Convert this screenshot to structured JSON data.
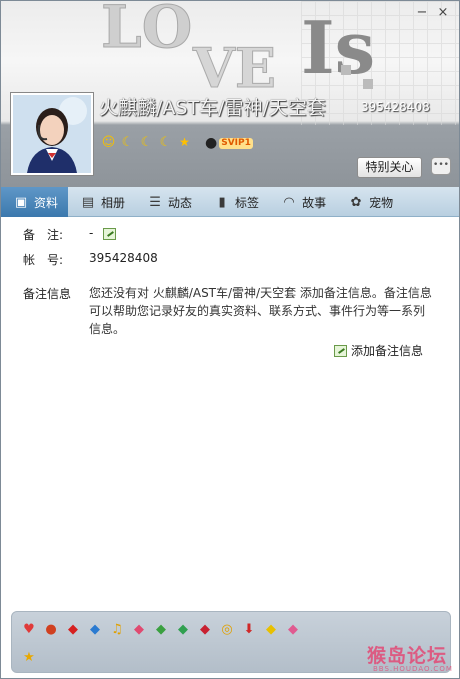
{
  "window": {
    "minimize_glyph": "−",
    "close_glyph": "×"
  },
  "header": {
    "nickname": "火麒麟/AST车/雷神/天空套",
    "qq_number": "395428408",
    "levels": [
      "sun-icon",
      "moon-icon",
      "moon-icon",
      "moon-icon",
      "star-icon"
    ],
    "svip_label": "SVIP1",
    "special_care_label": "特别关心",
    "chat_glyph": "•••"
  },
  "tabs": [
    {
      "label": "资料",
      "icon": "profile-card-icon",
      "glyph": "▣",
      "active": true
    },
    {
      "label": "相册",
      "icon": "album-icon",
      "glyph": "▤",
      "active": false
    },
    {
      "label": "动态",
      "icon": "feed-icon",
      "glyph": "☰",
      "active": false
    },
    {
      "label": "标签",
      "icon": "bookmark-icon",
      "glyph": "▮",
      "active": false
    },
    {
      "label": "故事",
      "icon": "signal-icon",
      "glyph": "◠",
      "active": false
    },
    {
      "label": "宠物",
      "icon": "pet-icon",
      "glyph": "✿",
      "active": false
    }
  ],
  "profile": {
    "remark_label": "备　注:",
    "remark_value": "-",
    "account_label": "帐　号:",
    "account_value": "395428408",
    "note_label": "备注信息",
    "note_text": "您还没有对 火麒麟/AST车/雷神/天空套 添加备注信息。备注信息可以帮助您记录好友的真实资料、联系方式、事件行为等一系列信息。",
    "add_note_label": "添加备注信息"
  },
  "bottom_icons": [
    {
      "icon": "heart-badge-icon",
      "glyph": "♥",
      "color": "#e03a3a"
    },
    {
      "icon": "penguin-icon",
      "glyph": "●",
      "color": "#d04020"
    },
    {
      "icon": "diamond-red-icon",
      "glyph": "◆",
      "color": "#d62020"
    },
    {
      "icon": "diamond-blue-icon",
      "glyph": "◆",
      "color": "#2a7ad0"
    },
    {
      "icon": "music-icon",
      "glyph": "♫",
      "color": "#e0a000"
    },
    {
      "icon": "diamond-pink-icon",
      "glyph": "◆",
      "color": "#e04a70"
    },
    {
      "icon": "diamond-green-icon",
      "glyph": "◆",
      "color": "#3aa040"
    },
    {
      "icon": "gem-green-icon",
      "glyph": "◆",
      "color": "#30a050"
    },
    {
      "icon": "gem-red-icon",
      "glyph": "◆",
      "color": "#c82030"
    },
    {
      "icon": "bell-icon",
      "glyph": "◎",
      "color": "#e0a000"
    },
    {
      "icon": "arrow-down-icon",
      "glyph": "⬇",
      "color": "#d02828"
    },
    {
      "icon": "diamond-yellow-icon",
      "glyph": "◆",
      "color": "#e8c000"
    },
    {
      "icon": "diamond-rose-icon",
      "glyph": "◆",
      "color": "#e05a90"
    }
  ],
  "bottom_icons_row2": [
    {
      "icon": "star-icon",
      "glyph": "★",
      "color": "#e8a800"
    }
  ],
  "watermark": {
    "text": "猴岛论坛",
    "sub": "BBS.HOUDAO.COM"
  }
}
